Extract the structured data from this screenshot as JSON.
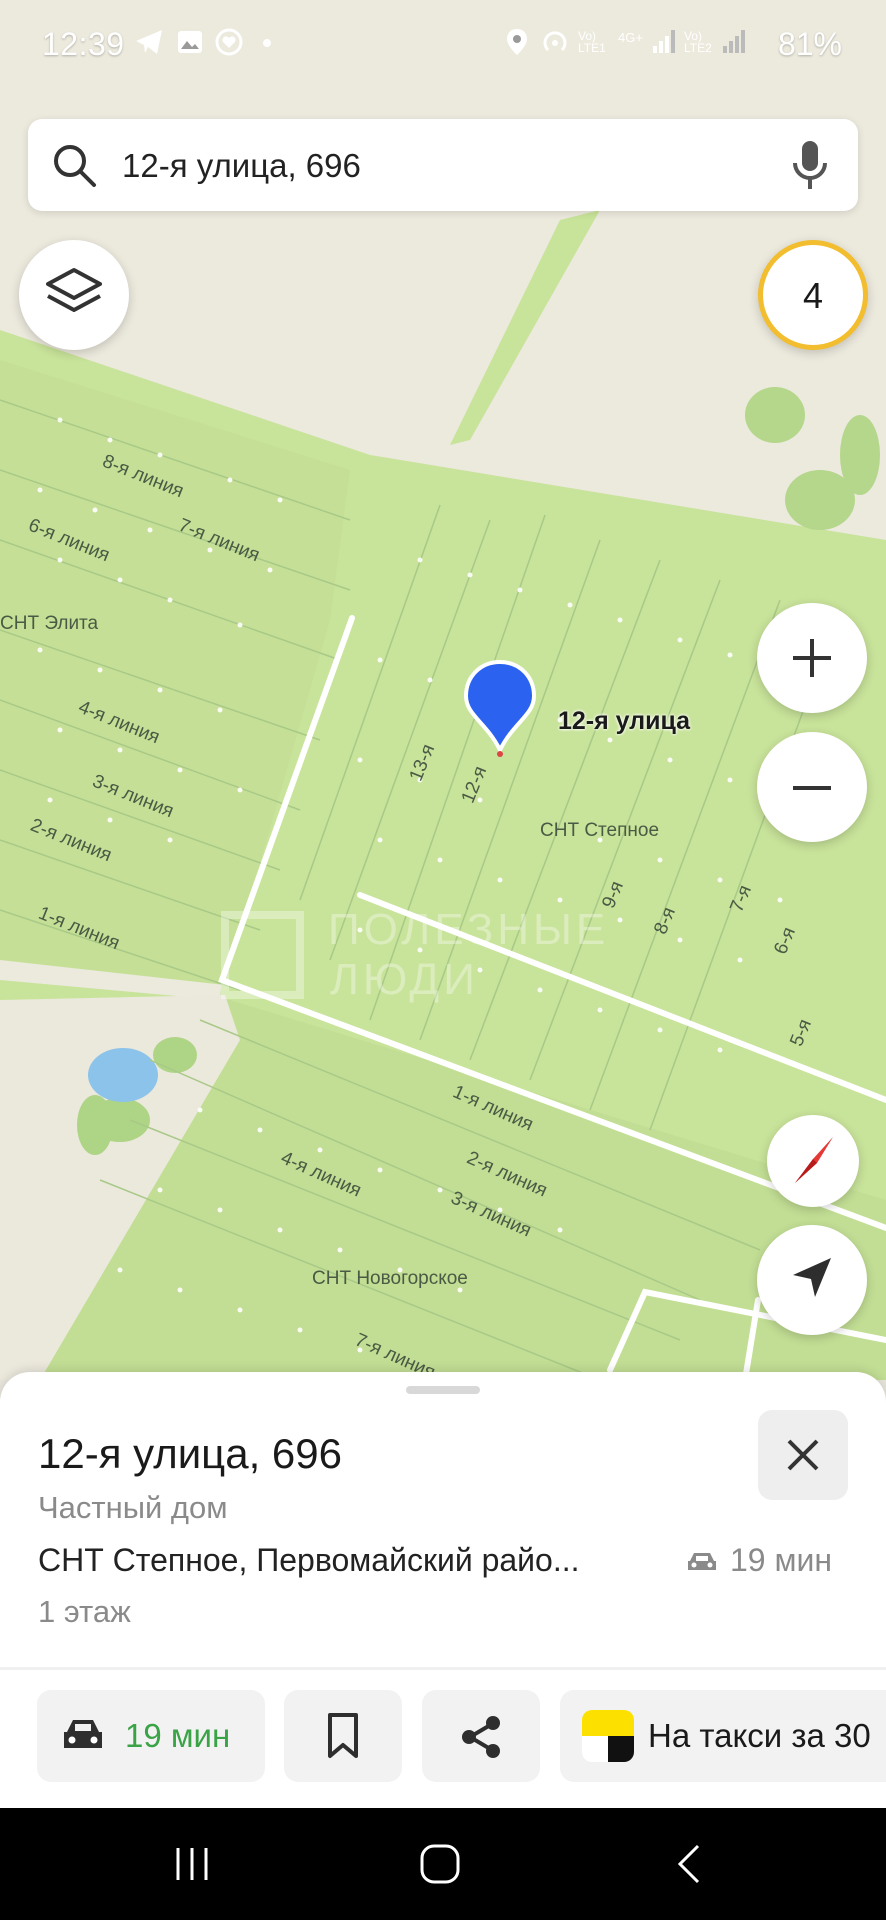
{
  "status_bar": {
    "time": "12:39",
    "battery": "81%",
    "net1": "Vo) LTE1",
    "net2": "4G+",
    "net3": "Vo) LTE2"
  },
  "search": {
    "value": "12-я улица, 696",
    "left_icon": "search-icon",
    "right_icon": "microphone-icon"
  },
  "map": {
    "layers_icon": "layers-icon",
    "badge_count": "4",
    "pin_label": "12-я улица",
    "labels": {
      "l8": "8-я линия",
      "l7": "7-я линия",
      "l6": "6-я линия",
      "snt_elita": "СНТ Элита",
      "l4": "4-я линия",
      "l3": "3-я линия",
      "l2": "2-я линия",
      "l1": "1-я линия",
      "s13": "13-я",
      "s12": "12-я",
      "snt_stepnoe": "СНТ Степное",
      "s9": "9-я",
      "s8": "8-я",
      "s7": "7-я",
      "s6": "6-я",
      "s5": "5-я",
      "r1": "1-я линия",
      "r2": "2-я линия",
      "r3": "3-я линия",
      "r4": "4-я линия",
      "r7": "7-я линия",
      "snt_novogorskoe": "СНТ Новогорское"
    },
    "watermark_line1": "ПОЛЕЗНЫЕ",
    "watermark_line2": "ЛЮДИ",
    "colors": {
      "field": "#c8e39a",
      "background": "#ece9dd",
      "road": "#ffffff",
      "water": "#8cc3ea",
      "pin": "#2b63f0",
      "badge_ring": "#f2bd2e"
    }
  },
  "sheet": {
    "title": "12-я улица, 696",
    "subtitle": "Частный дом",
    "address": "СНТ Степное, Первомайский райо...",
    "drive_time": "19 мин",
    "floor": "1 этаж",
    "actions": {
      "route_time": "19 мин",
      "taxi": "На такси за 30"
    },
    "accent_green": "#3aa346"
  }
}
